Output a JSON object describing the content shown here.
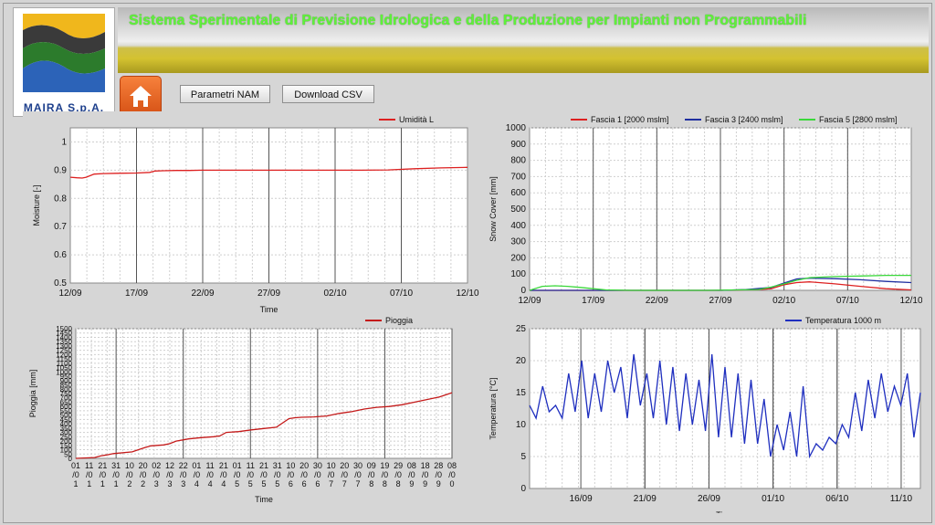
{
  "header": {
    "title": "Sistema Sperimentale di Previsione Idrologica e della Produzione per Impianti non Programmabili",
    "logo_text": "MAIRA S.p.A."
  },
  "toolbar": {
    "home_icon": "home-icon",
    "params_label": "Parametri NAM",
    "csv_label": "Download CSV"
  },
  "colors": {
    "accent": "#e8691e",
    "title": "#5ef23a",
    "grid": "#c8c8c8"
  },
  "chart_data": [
    {
      "id": "moisture",
      "type": "line",
      "xticks": [
        "12/09",
        "17/09",
        "22/09",
        "27/09",
        "02/10",
        "07/10",
        "12/10"
      ],
      "yticks": [
        "0.5",
        "0.6",
        "0.7",
        "0.8",
        "0.9",
        "1"
      ],
      "ylim": [
        0.5,
        1.05
      ],
      "ylabel": "Moisture [-]",
      "xlabel": "Time",
      "series": [
        {
          "name": "Umidità L",
          "color": "#dd2020",
          "x": [
            0,
            0.5,
            0.9,
            1.2,
            1.8,
            2.5,
            3.5,
            5,
            6,
            6.4,
            7,
            8,
            9,
            10,
            12,
            14,
            16,
            18,
            20,
            22,
            24,
            26,
            28,
            30
          ],
          "y": [
            0.875,
            0.873,
            0.872,
            0.875,
            0.886,
            0.888,
            0.889,
            0.89,
            0.892,
            0.897,
            0.898,
            0.899,
            0.899,
            0.9,
            0.9,
            0.9,
            0.9,
            0.9,
            0.9,
            0.9,
            0.901,
            0.905,
            0.908,
            0.91
          ]
        }
      ]
    },
    {
      "id": "snow",
      "type": "line",
      "xticks": [
        "12/09",
        "17/09",
        "22/09",
        "27/09",
        "02/10",
        "07/10",
        "12/10"
      ],
      "yticks": [
        "0",
        "100",
        "200",
        "300",
        "400",
        "500",
        "600",
        "700",
        "800",
        "900",
        "1000"
      ],
      "ylim": [
        0,
        1000
      ],
      "ylabel": "Snow Cover [mm]",
      "xlabel": "Time",
      "series": [
        {
          "name": "Fascia 1 [2000 mslm]",
          "color": "#dd2020",
          "x": [
            0,
            15,
            16,
            18,
            19,
            20,
            21,
            22,
            24,
            26,
            28,
            30
          ],
          "y": [
            0,
            0,
            2,
            5,
            10,
            35,
            48,
            52,
            40,
            25,
            10,
            3
          ]
        },
        {
          "name": "Fascia 3 [2400 mslm]",
          "color": "#1f2fa0",
          "x": [
            0,
            15,
            17,
            19,
            20,
            21,
            22,
            24,
            26,
            28,
            30
          ],
          "y": [
            0,
            0,
            5,
            18,
            45,
            70,
            75,
            72,
            65,
            55,
            48
          ]
        },
        {
          "name": "Fascia 5 [2800 mslm]",
          "color": "#3ad83a",
          "x": [
            0,
            1,
            2,
            3,
            4,
            5,
            6,
            8,
            14,
            18,
            19,
            20,
            21,
            22,
            24,
            26,
            28,
            30
          ],
          "y": [
            0,
            25,
            28,
            25,
            18,
            10,
            3,
            0,
            0,
            5,
            20,
            40,
            62,
            78,
            85,
            88,
            92,
            92
          ]
        }
      ]
    },
    {
      "id": "rain",
      "type": "line",
      "xticks": [
        "01/01",
        "11/01",
        "21/01",
        "31/01",
        "10/02",
        "20/02",
        "02/03",
        "12/03",
        "22/03",
        "01/04",
        "11/04",
        "21/04",
        "01/05",
        "11/05",
        "21/05",
        "31/05",
        "10/06",
        "20/06",
        "30/06",
        "10/07",
        "20/07",
        "30/07",
        "09/08",
        "19/08",
        "29/08",
        "08/09",
        "18/09",
        "28/09",
        "08/10"
      ],
      "yticks": [
        "0",
        "50",
        "100",
        "150",
        "200",
        "250",
        "300",
        "350",
        "400",
        "450",
        "500",
        "550",
        "600",
        "650",
        "700",
        "750",
        "800",
        "850",
        "900",
        "950",
        "1000",
        "1050",
        "1100",
        "1150",
        "1200",
        "1250",
        "1300",
        "1350",
        "1400",
        "1450",
        "1500"
      ],
      "ylim": [
        0,
        1500
      ],
      "ylabel": "Pioggia [mm]",
      "xlabel": "Time",
      "series": [
        {
          "name": "Pioggia",
          "color": "#c41a1a",
          "x": [
            0,
            15,
            20,
            25,
            30,
            45,
            50,
            55,
            60,
            70,
            75,
            80,
            90,
            100,
            110,
            115,
            120,
            130,
            140,
            150,
            160,
            170,
            175,
            180,
            190,
            200,
            210,
            220,
            230,
            240,
            250,
            260,
            270,
            280,
            290,
            300
          ],
          "y": [
            0,
            10,
            30,
            40,
            55,
            75,
            100,
            125,
            145,
            155,
            170,
            200,
            225,
            240,
            250,
            260,
            300,
            310,
            330,
            345,
            360,
            460,
            470,
            475,
            480,
            490,
            520,
            540,
            570,
            590,
            600,
            620,
            650,
            680,
            710,
            760
          ]
        }
      ]
    },
    {
      "id": "temp",
      "type": "line",
      "xticks": [
        "16/09",
        "21/09",
        "26/09",
        "01/10",
        "06/10",
        "11/10"
      ],
      "yticks": [
        "0",
        "5",
        "10",
        "15",
        "20",
        "25"
      ],
      "ylim": [
        0,
        25
      ],
      "ylabel": "Temperatura [°C]",
      "xlabel": "Time",
      "series": [
        {
          "name": "Temperatura 1000 m",
          "color": "#1f2fbf",
          "x": [
            0,
            0.5,
            1,
            1.5,
            2,
            2.5,
            3,
            3.5,
            4,
            4.5,
            5,
            5.5,
            6,
            6.5,
            7,
            7.5,
            8,
            8.5,
            9,
            9.5,
            10,
            10.5,
            11,
            11.5,
            12,
            12.5,
            13,
            13.5,
            14,
            14.5,
            15,
            15.5,
            16,
            16.5,
            17,
            17.5,
            18,
            18.5,
            19,
            19.5,
            20,
            20.5,
            21,
            21.5,
            22,
            22.5,
            23,
            23.5,
            24,
            24.5,
            25,
            25.5,
            26,
            26.5,
            27,
            27.5,
            28,
            28.5,
            29,
            29.5,
            30
          ],
          "y": [
            13,
            11,
            16,
            12,
            13,
            11,
            18,
            12,
            20,
            11,
            18,
            12,
            20,
            15,
            19,
            11,
            21,
            13,
            18,
            11,
            20,
            10,
            19,
            9,
            18,
            10,
            17,
            9,
            21,
            8,
            19,
            8,
            18,
            7,
            17,
            7,
            14,
            5,
            10,
            6,
            12,
            5,
            16,
            5,
            7,
            6,
            8,
            7,
            10,
            8,
            15,
            9,
            17,
            11,
            18,
            12,
            16,
            13,
            18,
            8,
            15
          ]
        }
      ]
    }
  ]
}
